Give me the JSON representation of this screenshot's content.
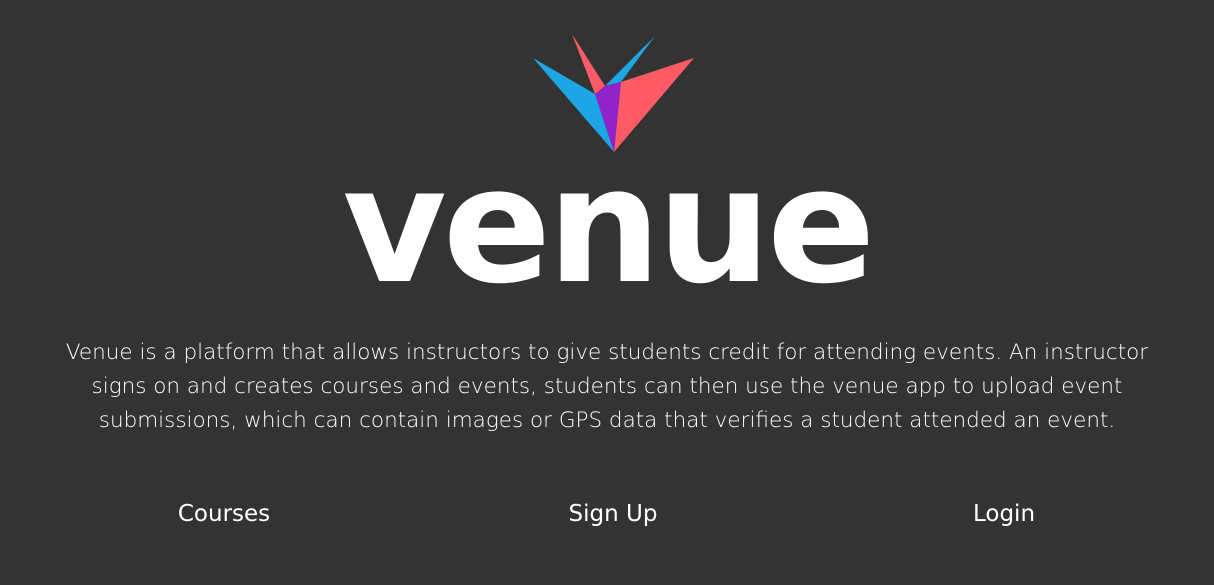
{
  "logo": {
    "wordmark": "venue",
    "colors": {
      "blue": "#1da6e5",
      "red": "#ff5b66",
      "purple": "#9124c9"
    }
  },
  "description": "Venue is a platform that allows instructors to give students credit for attending events. An instructor signs on and creates courses and events, students can then use the venue app to upload event submissions, which can contain images or GPS data that verifies a student attended an event.",
  "nav": {
    "courses": "Courses",
    "signup": "Sign Up",
    "login": "Login"
  }
}
